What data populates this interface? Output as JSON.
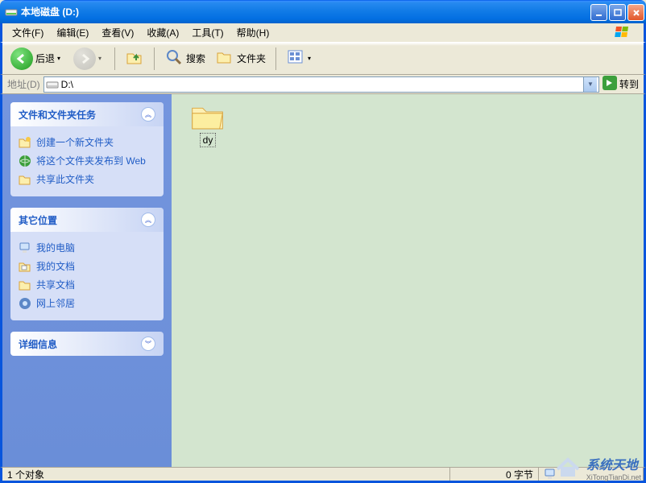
{
  "titlebar": {
    "text": "本地磁盘 (D:)"
  },
  "menu": {
    "file": "文件(F)",
    "edit": "编辑(E)",
    "view": "查看(V)",
    "favorites": "收藏(A)",
    "tools": "工具(T)",
    "help": "帮助(H)"
  },
  "toolbar": {
    "back": "后退",
    "search": "搜索",
    "folders": "文件夹"
  },
  "addressbar": {
    "label": "地址(D)",
    "value": "D:\\",
    "go": "转到"
  },
  "sidebar": {
    "tasks": {
      "title": "文件和文件夹任务",
      "items": [
        {
          "label": "创建一个新文件夹"
        },
        {
          "label": "将这个文件夹发布到 Web"
        },
        {
          "label": "共享此文件夹"
        }
      ]
    },
    "places": {
      "title": "其它位置",
      "items": [
        {
          "label": "我的电脑"
        },
        {
          "label": "我的文档"
        },
        {
          "label": "共享文档"
        },
        {
          "label": "网上邻居"
        }
      ]
    },
    "details": {
      "title": "详细信息"
    }
  },
  "content": {
    "folder_name": "dy"
  },
  "statusbar": {
    "objects": "1 个对象",
    "size": "0 字节"
  },
  "watermark": {
    "line1": "系统天地",
    "line2": "XiTongTianDi.net"
  }
}
